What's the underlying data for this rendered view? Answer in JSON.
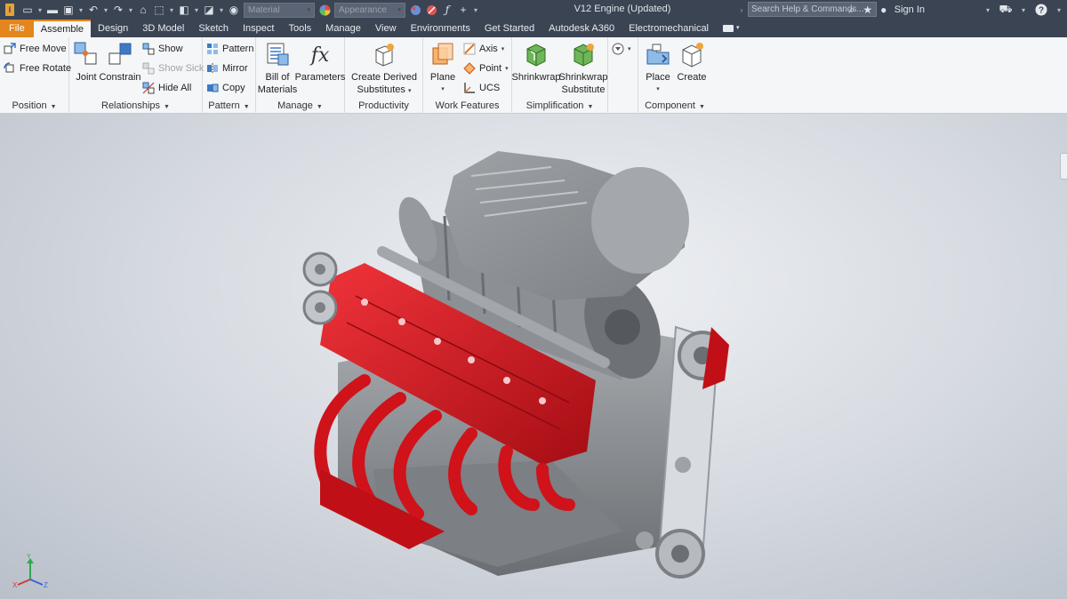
{
  "app": {
    "logo_letter": "I",
    "window_title": "V12 Engine (Updated)"
  },
  "quick_access": {
    "material_combo": "Material",
    "appearance_combo": "Appearance",
    "search_placeholder": "Search Help & Commands...",
    "sign_in": "Sign In"
  },
  "tabs": [
    {
      "label": "File"
    },
    {
      "label": "Assemble"
    },
    {
      "label": "Design"
    },
    {
      "label": "3D Model"
    },
    {
      "label": "Sketch"
    },
    {
      "label": "Inspect"
    },
    {
      "label": "Tools"
    },
    {
      "label": "Manage"
    },
    {
      "label": "View"
    },
    {
      "label": "Environments"
    },
    {
      "label": "Get Started"
    },
    {
      "label": "Autodesk A360"
    },
    {
      "label": "Electromechanical"
    }
  ],
  "ribbon": {
    "position": {
      "label": "Position",
      "free_move": "Free Move",
      "free_rotate": "Free Rotate"
    },
    "relationships": {
      "label": "Relationships",
      "joint": "Joint",
      "constrain": "Constrain",
      "show": "Show",
      "show_sick": "Show Sick",
      "hide_all": "Hide All"
    },
    "pattern": {
      "label": "Pattern",
      "pattern": "Pattern",
      "mirror": "Mirror",
      "copy": "Copy"
    },
    "manage": {
      "label": "Manage",
      "bom_line1": "Bill of",
      "bom_line2": "Materials",
      "parameters": "Parameters"
    },
    "productivity": {
      "label": "Productivity",
      "cds_line1": "Create Derived",
      "cds_line2": "Substitutes"
    },
    "work_features": {
      "label": "Work Features",
      "plane": "Plane",
      "axis": "Axis",
      "point": "Point",
      "ucs": "UCS"
    },
    "simplification": {
      "label": "Simplification",
      "shrinkwrap": "Shrinkwrap",
      "sws_line1": "Shrinkwrap",
      "sws_line2": "Substitute"
    },
    "component": {
      "label": "Component",
      "place": "Place",
      "create": "Create"
    }
  },
  "viewport": {
    "triad_x": "X",
    "triad_y": "Y",
    "triad_z": "Z"
  },
  "colors": {
    "engine_red": "#d0121b",
    "engine_grey": "#8f9296",
    "accent_orange": "#e4861d",
    "titlebar": "#3b4453"
  }
}
